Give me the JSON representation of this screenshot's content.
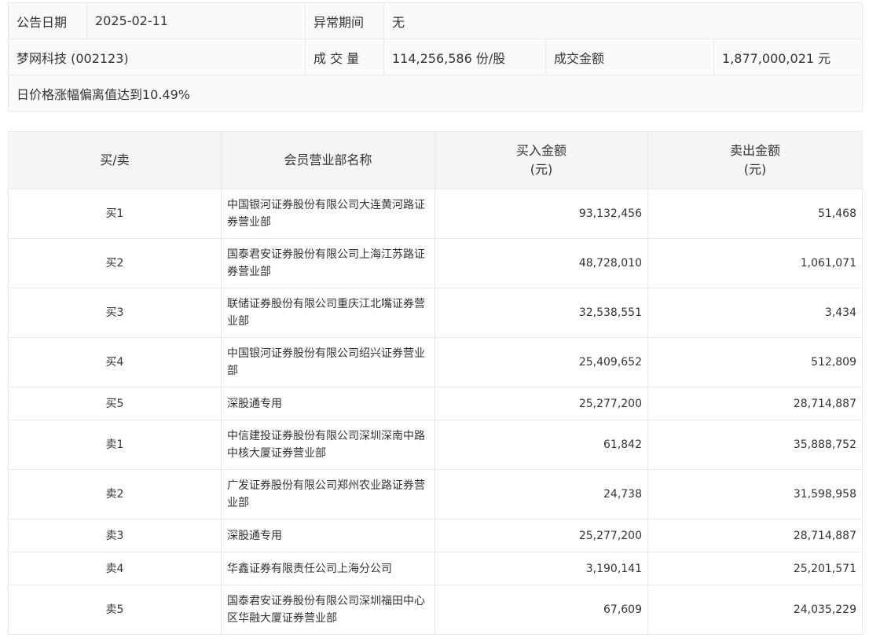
{
  "info": {
    "announce_date_label": "公告日期",
    "announce_date": "2025-02-11",
    "abnormal_period_label": "异常期间",
    "abnormal_period": "无",
    "stock": "梦网科技 (002123)",
    "volume_label": "成 交 量",
    "volume": "114,256,586 份/股",
    "turnover_label": "成交金额",
    "turnover": "1,877,000,021 元",
    "reason": "日价格涨幅偏离值达到10.49%"
  },
  "table": {
    "headers": {
      "side": "买/卖",
      "name": "会员营业部名称",
      "buy": "买入金额",
      "buy_unit": "(元)",
      "sell": "卖出金额",
      "sell_unit": "(元)"
    },
    "rows": [
      {
        "side": "买1",
        "name": "中国银河证券股份有限公司大连黄河路证券营业部",
        "buy": "93,132,456",
        "sell": "51,468"
      },
      {
        "side": "买2",
        "name": "国泰君安证券股份有限公司上海江苏路证券营业部",
        "buy": "48,728,010",
        "sell": "1,061,071"
      },
      {
        "side": "买3",
        "name": "联储证券股份有限公司重庆江北嘴证券营业部",
        "buy": "32,538,551",
        "sell": "3,434"
      },
      {
        "side": "买4",
        "name": "中国银河证券股份有限公司绍兴证券营业部",
        "buy": "25,409,652",
        "sell": "512,809"
      },
      {
        "side": "买5",
        "name": "深股通专用",
        "buy": "25,277,200",
        "sell": "28,714,887"
      },
      {
        "side": "卖1",
        "name": "中信建投证券股份有限公司深圳深南中路中核大厦证券营业部",
        "buy": "61,842",
        "sell": "35,888,752"
      },
      {
        "side": "卖2",
        "name": "广发证券股份有限公司郑州农业路证券营业部",
        "buy": "24,738",
        "sell": "31,598,958"
      },
      {
        "side": "卖3",
        "name": "深股通专用",
        "buy": "25,277,200",
        "sell": "28,714,887"
      },
      {
        "side": "卖4",
        "name": "华鑫证券有限责任公司上海分公司",
        "buy": "3,190,141",
        "sell": "25,201,571"
      },
      {
        "side": "卖5",
        "name": "国泰君安证券股份有限公司深圳福田中心区华融大厦证券营业部",
        "buy": "67,609",
        "sell": "24,035,229"
      }
    ]
  }
}
